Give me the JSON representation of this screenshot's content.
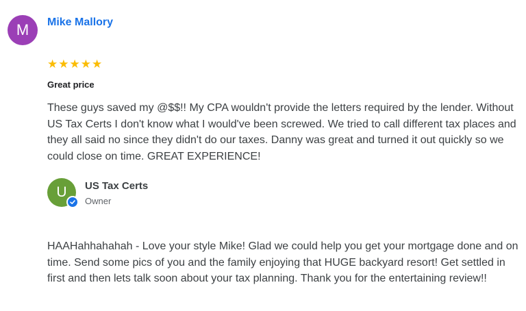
{
  "review": {
    "avatar_letter": "M",
    "avatar_color": "#9b3fb6",
    "name": "Mike Mallory",
    "name_color": "#1a73e8",
    "rating": 5,
    "max_rating": 5,
    "star_color": "#fbbc04",
    "title": "Great price",
    "text": "These guys saved my @$$!! My CPA wouldn't provide the letters required by the lender. Without US Tax Certs I don't know what I would've been screwed. We tried to call different tax places and they all said no since they didn't do our taxes. Danny was great and turned it out quickly so we could close on time. GREAT EXPERIENCE!"
  },
  "owner_reply": {
    "avatar_letter": "U",
    "avatar_color": "#689f38",
    "verified_icon": "verified-check-icon",
    "name": "US Tax Certs",
    "role": "Owner",
    "text": "HAAHahhahahah - Love your style Mike! Glad we could help you get your mortgage done and on time. Send some pics of you and the family enjoying that HUGE backyard resort! Get settled in first and then lets talk soon about your tax planning. Thank you for the entertaining review!!"
  }
}
